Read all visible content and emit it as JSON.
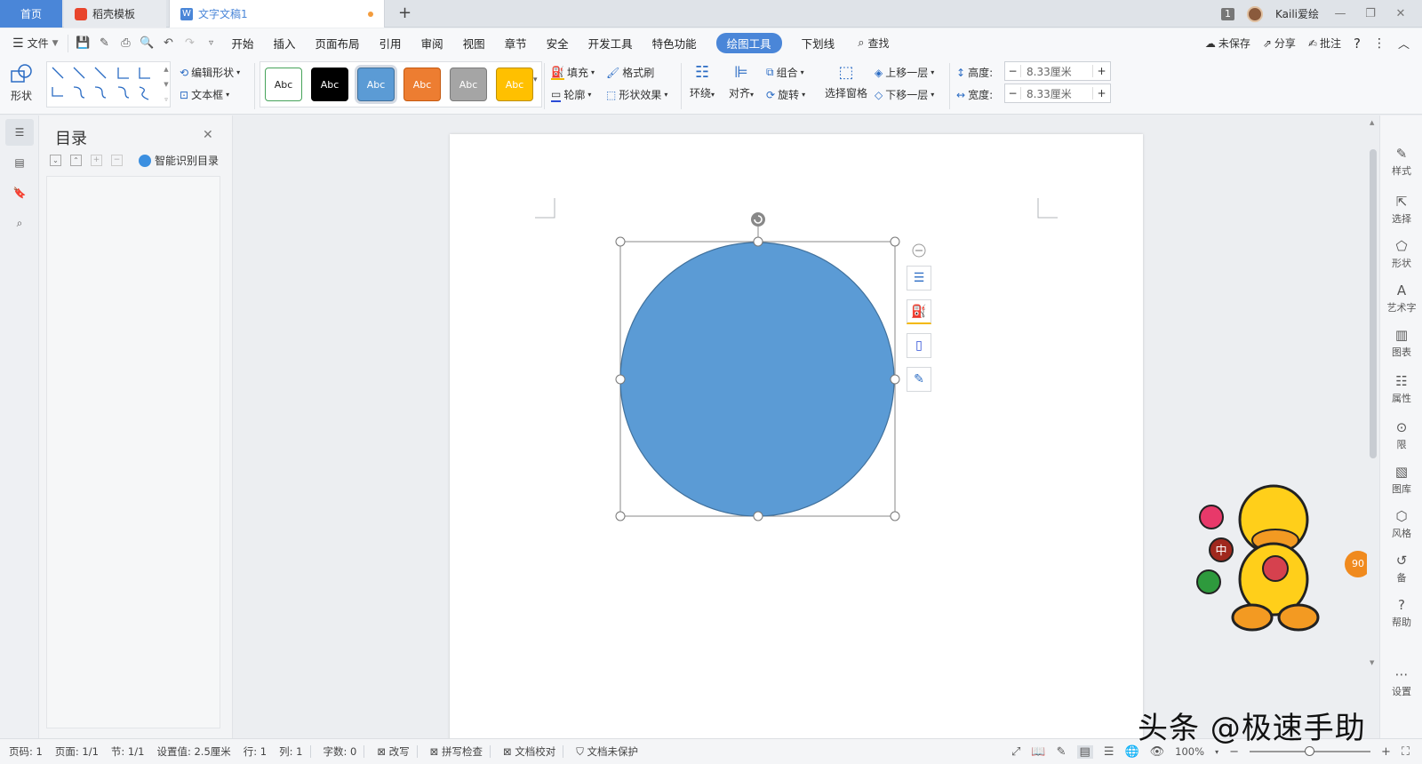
{
  "tabs": {
    "home": "首页",
    "template": "稻壳模板",
    "document": "文字文稿1",
    "add": "+"
  },
  "window": {
    "page_count_badge": "1",
    "username": "Kaili爱绘",
    "minimize": "—",
    "restore": "❐",
    "close": "✕"
  },
  "menu": {
    "file": "文件",
    "items": [
      "开始",
      "插入",
      "页面布局",
      "引用",
      "审阅",
      "视图",
      "章节",
      "安全",
      "开发工具",
      "特色功能",
      "绘图工具",
      "下划线"
    ],
    "active": "绘图工具",
    "search": "查找",
    "right": {
      "unsaved": "未保存",
      "share": "分享",
      "comment": "批注",
      "help": "?",
      "more": "⋮",
      "collapse": "︿"
    }
  },
  "ribbon": {
    "shape": "形状",
    "edit_shape": "编辑形状",
    "textbox": "文本框",
    "styles": [
      {
        "label": "Abc",
        "bg": "#ffffff",
        "fg": "#222222",
        "border": "#46a35a"
      },
      {
        "label": "Abc",
        "bg": "#000000",
        "fg": "#ffffff",
        "border": "#000000"
      },
      {
        "label": "Abc",
        "bg": "#5b9bd5",
        "fg": "#ffffff",
        "border": "#41719c"
      },
      {
        "label": "Abc",
        "bg": "#ed7d31",
        "fg": "#ffffff",
        "border": "#c55a11"
      },
      {
        "label": "Abc",
        "bg": "#a5a5a5",
        "fg": "#ffffff",
        "border": "#7b7b7b"
      },
      {
        "label": "Abc",
        "bg": "#ffc000",
        "fg": "#ffffff",
        "border": "#bf9000"
      }
    ],
    "fill": "填充",
    "outline": "轮廓",
    "format_painter": "格式刷",
    "shape_effect": "形状效果",
    "wrap": "环绕",
    "align": "对齐",
    "group": "组合",
    "rotate": "旋转",
    "selection_pane": "选择窗格",
    "bring_forward": "上移一层",
    "send_backward": "下移一层",
    "height_label": "高度:",
    "height_value": "8.33厘米",
    "width_label": "宽度:",
    "width_value": "8.33厘米"
  },
  "nav": {
    "title": "目录",
    "smart_toc": "智能识别目录"
  },
  "shape": {
    "fill": "#5b9bd5",
    "stroke": "#41719c"
  },
  "right_rail": [
    "样式",
    "选择",
    "形状",
    "艺术字",
    "图表",
    "属性",
    "限",
    "图库",
    "风格",
    "备",
    "帮助",
    "设置"
  ],
  "status": {
    "page_code": "页码: 1",
    "page": "页面: 1/1",
    "section": "节: 1/1",
    "setting": "设置值: 2.5厘米",
    "row": "行: 1",
    "col": "列: 1",
    "words": "字数: 0",
    "revise": "改写",
    "spell": "拼写检查",
    "proof": "文档校对",
    "protect": "文档未保护",
    "zoom": "100%"
  },
  "sticker": {
    "zhong": "中",
    "badge": "90"
  },
  "watermark": "头条 @极速手助"
}
